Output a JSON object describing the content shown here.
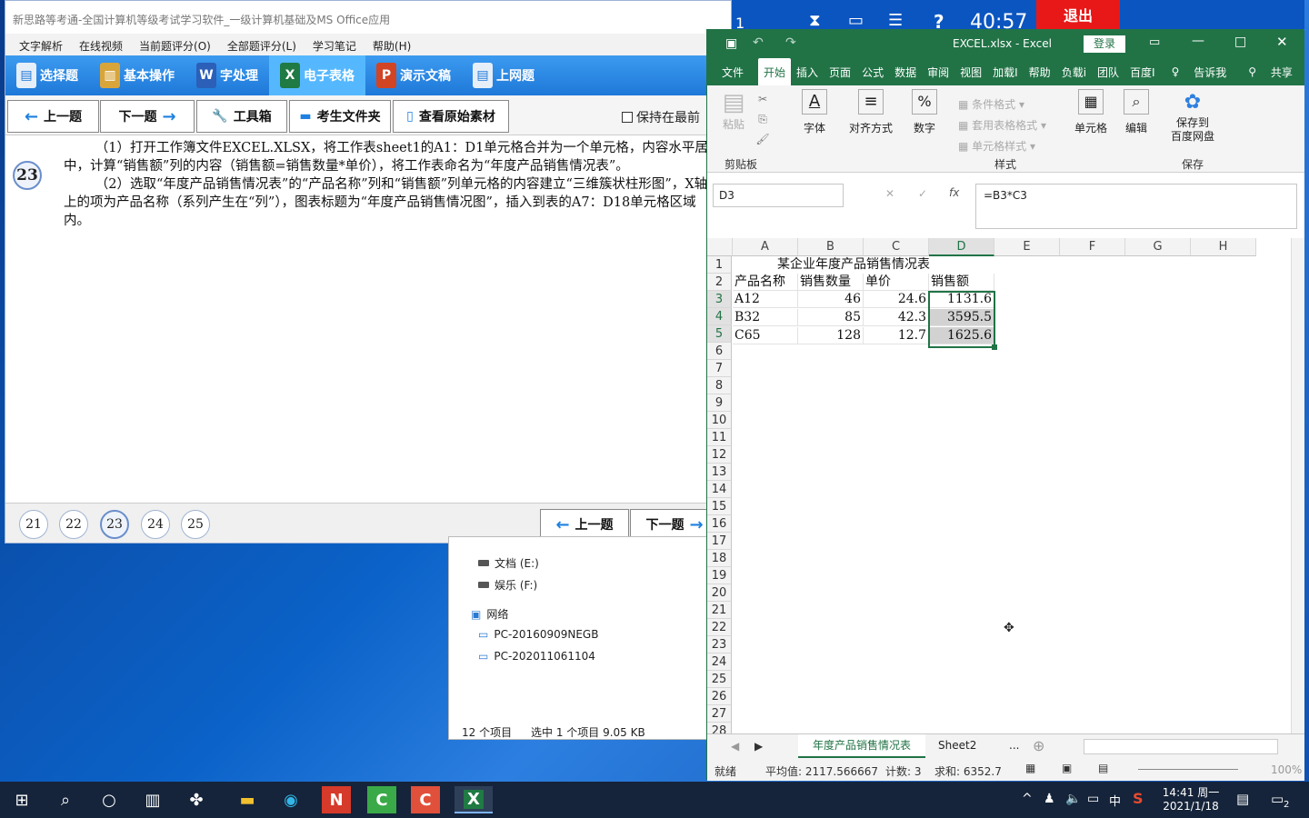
{
  "exam": {
    "title": "新思路等考通-全国计算机等级考试学习软件_一级计算机基础及MS Office应用",
    "menu": [
      "文字解析",
      "在线视频",
      "当前题评分(O)",
      "全部题评分(L)",
      "学习笔记",
      "帮助(H)"
    ],
    "tools": [
      "选择题",
      "基本操作",
      "字处理",
      "电子表格",
      "演示文稿",
      "上网题"
    ],
    "nav": {
      "prev": "上一题",
      "next": "下一题",
      "toolbox": "工具箱",
      "folder": "考生文件夹",
      "original": "查看原始素材",
      "keep_front": "保持在最前"
    },
    "question_number": "23",
    "question_p1": "（1）打开工作簿文件EXCEL.XLSX，将工作表sheet1的A1：D1单元格合并为一个单元格，内容水平居中，计算“销售额”列的内容（销售额=销售数量*单价），将工作表命名为“年度产品销售情况表”。",
    "question_p2": "（2）选取“年度产品销售情况表”的“产品名称”列和“销售额”列单元格的内容建立“三维簇状柱形图”，X轴上的项为产品名称（系列产生在“列”），图表标题为“年度产品销售情况图”，插入到表的A7：D18单元格区域内。",
    "circles": [
      "21",
      "22",
      "23",
      "24",
      "25"
    ],
    "foot_prev": "上一题",
    "foot_next": "下一题"
  },
  "explorer": {
    "drive_e": "文档 (E:)",
    "drive_f": "娱乐 (F:)",
    "network": "网络",
    "pc1": "PC-20160909NEGB",
    "pc2": "PC-202011061104",
    "status_count": "12 个项目",
    "status_sel": "选中 1 个项目  9.05 KB"
  },
  "timer": {
    "time": "40:57",
    "exit": "退出",
    "num": "1"
  },
  "excel": {
    "title": "EXCEL.xlsx  -  Excel",
    "login": "登录",
    "tabs": [
      "文件",
      "开始",
      "插入",
      "页面",
      "公式",
      "数据",
      "审阅",
      "视图",
      "加载I",
      "帮助",
      "负载i",
      "团队",
      "百度I",
      "告诉我",
      "共享"
    ],
    "ribbon": {
      "paste": "粘贴",
      "clipboard": "剪贴板",
      "font": "字体",
      "align": "对齐方式",
      "number": "数字",
      "cond": "条件格式",
      "table": "套用表格格式",
      "cellstyle": "单元格样式",
      "styles": "样式",
      "cells": "单元格",
      "edit": "编辑",
      "save1": "保存到",
      "save2": "百度网盘",
      "save": "保存"
    },
    "namebox": "D3",
    "formula": "=B3*C3",
    "columns": [
      "A",
      "B",
      "C",
      "D",
      "E",
      "F",
      "G",
      "H"
    ],
    "rows": [
      "1",
      "2",
      "3",
      "4",
      "5",
      "6",
      "7",
      "8",
      "9",
      "10",
      "11",
      "12",
      "13",
      "14",
      "15",
      "16",
      "17",
      "18",
      "19",
      "20",
      "21",
      "22",
      "23",
      "24",
      "25",
      "26",
      "27",
      "28"
    ],
    "cells": {
      "title": "某企业年度产品销售情况表",
      "header": [
        "产品名称",
        "销售数量",
        "单价",
        "销售额"
      ],
      "data": [
        [
          "A12",
          "46",
          "24.6",
          "1131.6"
        ],
        [
          "B32",
          "85",
          "42.3",
          "3595.5"
        ],
        [
          "C65",
          "128",
          "12.7",
          "1625.6"
        ]
      ]
    },
    "sheets": [
      "年度产品销售情况表",
      "Sheet2",
      "..."
    ],
    "status": {
      "ready": "就绪",
      "avg": "平均值: 2117.566667",
      "count": "计数: 3",
      "sum": "求和: 6352.7",
      "zoom": "100%"
    }
  },
  "taskbar": {
    "ime": "中",
    "time": "14:41 周一",
    "date": "2021/1/18",
    "notif": "2"
  },
  "colors": {
    "excel_green": "#217346",
    "tool_blue": "#1e78d8",
    "exit_red": "#e81818"
  }
}
